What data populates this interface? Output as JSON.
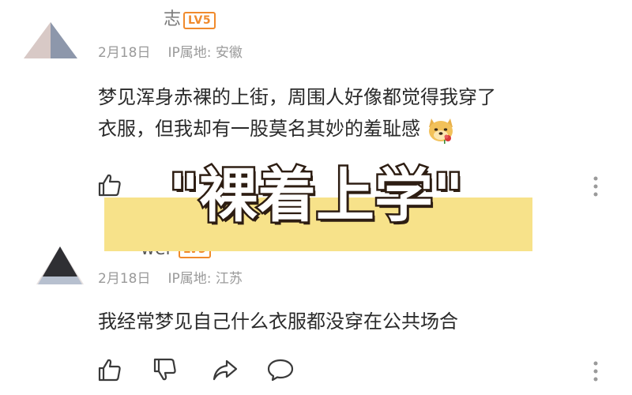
{
  "comments": [
    {
      "username": "志",
      "level": "LV5",
      "date": "2月18日",
      "ip_location": "IP属地: 安徽",
      "lines": [
        "梦见浑身赤裸的上街，周围人好像都觉得我穿了",
        "衣服，但我却有一股莫名其妙的羞耻感"
      ],
      "emoji": "doge-rose-emoji"
    },
    {
      "username": "wei",
      "level": "LV5",
      "date": "2月18日",
      "ip_location": "IP属地: 江苏",
      "lines": [
        "我经常梦见自己什么衣服都没穿在公共场合"
      ]
    }
  ],
  "overlay": {
    "title": "\"裸着上学\""
  },
  "icons": {
    "like": "thumbs-up-icon",
    "dislike": "thumbs-down-icon",
    "share": "share-icon",
    "comment": "comment-icon",
    "more": "more-vertical-icon"
  },
  "colors": {
    "level_badge": "#f08a2c",
    "meta_text": "#9a9a9a",
    "overlay_band": "#f7e28a",
    "overlay_stroke": "#2d1d12"
  }
}
